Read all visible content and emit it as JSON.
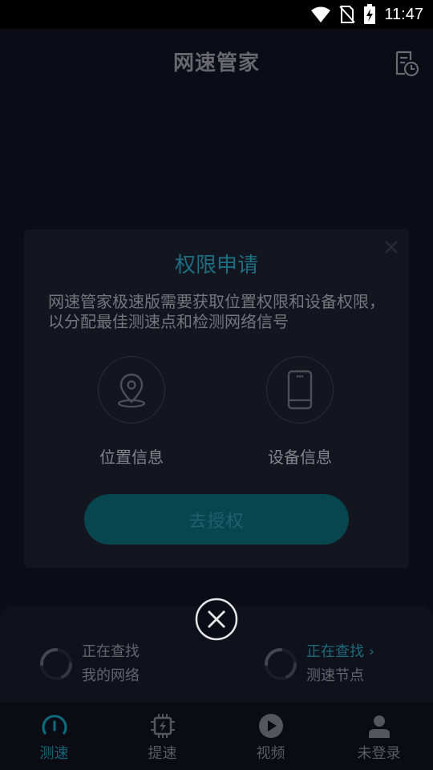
{
  "status_bar": {
    "time": "11:47"
  },
  "header": {
    "title": "网速管家"
  },
  "dialog": {
    "title": "权限申请",
    "description": "网速管家极速版需要获取位置权限和设备权限，以分配最佳测速点和检测网络信号",
    "permissions": [
      {
        "label": "位置信息",
        "icon": "location-pin-icon"
      },
      {
        "label": "设备信息",
        "icon": "phone-device-icon"
      }
    ],
    "authorize_label": "去授权"
  },
  "panel": {
    "network": {
      "line1": "正在查找",
      "line2": "我的网络"
    },
    "node": {
      "line1": "正在查找",
      "arrow": "›",
      "line2": "测速节点"
    }
  },
  "nav": {
    "items": [
      {
        "label": "测速",
        "icon": "speedometer-icon",
        "active": true
      },
      {
        "label": "提速",
        "icon": "boost-chip-icon",
        "active": false
      },
      {
        "label": "视频",
        "icon": "play-icon",
        "active": false
      },
      {
        "label": "未登录",
        "icon": "user-icon",
        "active": false
      }
    ]
  },
  "colors": {
    "accent": "#0f6778",
    "background": "#0b0c16",
    "dialog": "#14161f"
  }
}
